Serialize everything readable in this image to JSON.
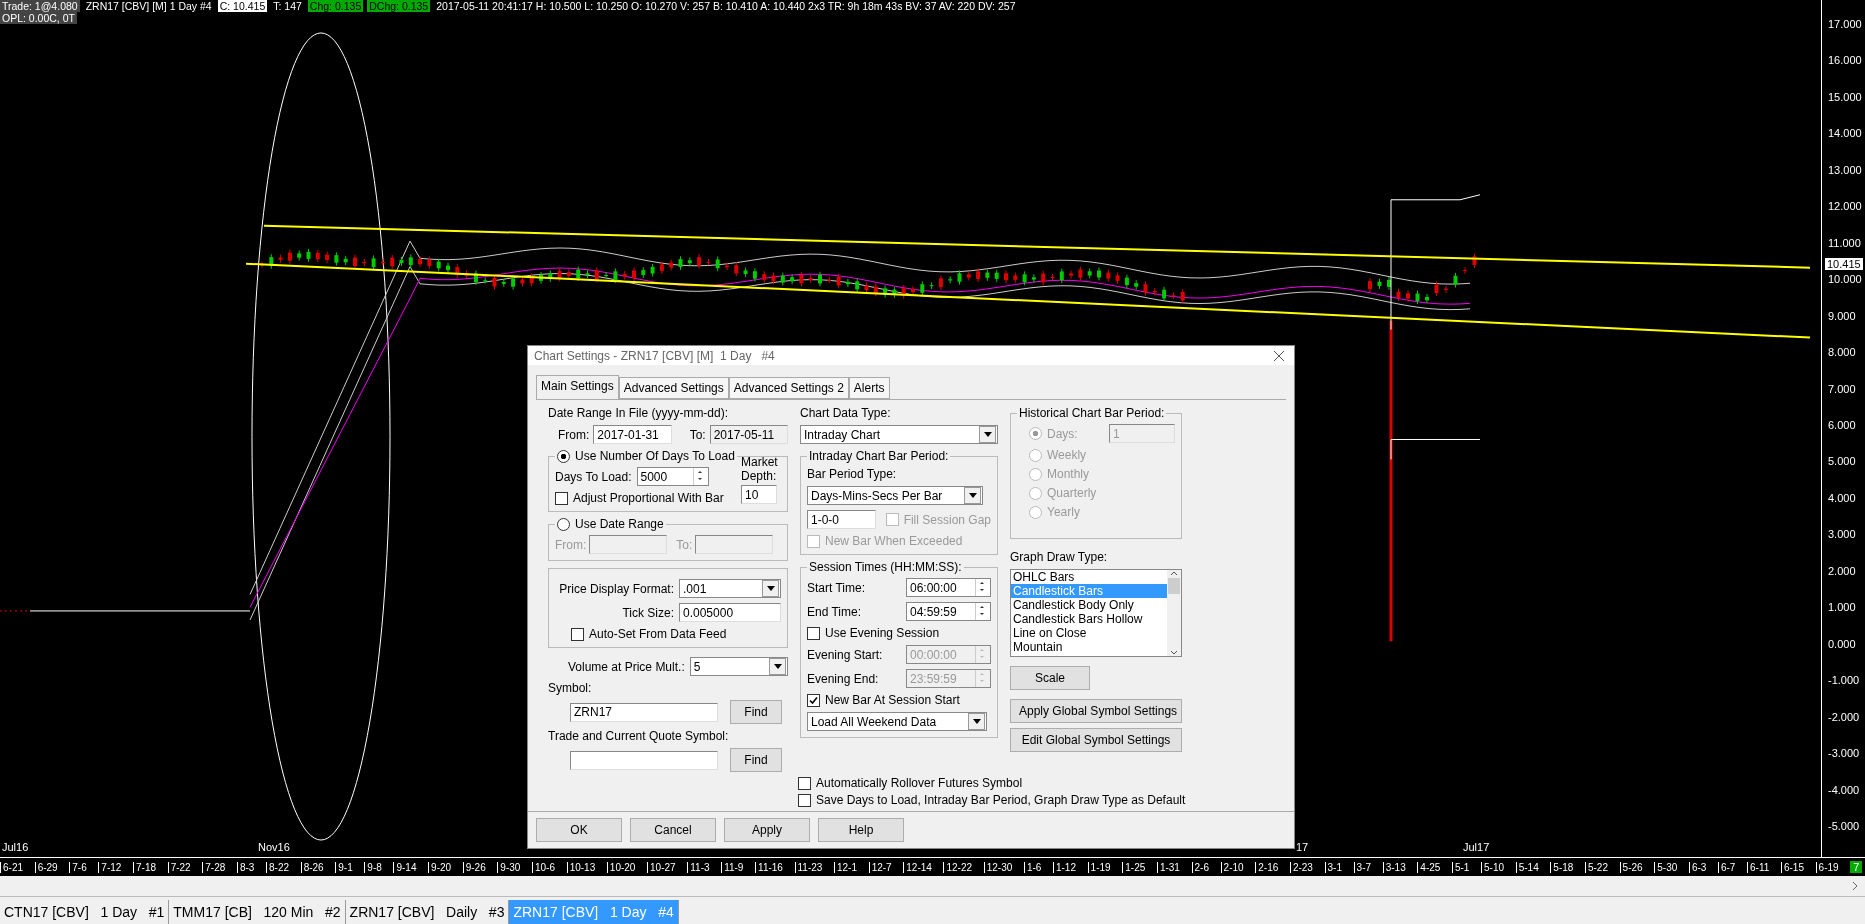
{
  "header": {
    "trade": "Trade: 1@4.080",
    "symbol": "ZRN17 [CBV] [M]  1 Day   #4",
    "close": "C: 10.415",
    "ticks": "T: 147",
    "change": "Chg: 0.135",
    "day_change": "DChg: 0.135",
    "details": "2017-05-11 20:41:17 H: 10.500 L: 10.250 O: 10.270 V: 257 B: 10.410 A: 10.440 2x3 TR: 9h 18m 43s BV: 37 AV: 220 DV: 257",
    "opl": "OPL: 0.00C, 0T"
  },
  "chart": {
    "month_labels": [
      "Jul16",
      "Nov16",
      "17",
      "Jul17"
    ],
    "price_axis": [
      "17.000",
      "16.000",
      "15.000",
      "14.000",
      "13.000",
      "12.000",
      "11.000",
      "10.000",
      "9.000",
      "8.000",
      "7.000",
      "6.000",
      "5.000",
      "4.000",
      "3.000",
      "2.000",
      "1.000",
      "0.000",
      "-1.000",
      "-2.000",
      "-3.000",
      "-4.000",
      "-5.000"
    ],
    "last_price": "10.415",
    "date_axis": [
      "6-21",
      "6-29",
      "7-6",
      "7-12",
      "7-18",
      "7-22",
      "7-28",
      "8-3",
      "8-22",
      "8-26",
      "9-1",
      "9-8",
      "9-14",
      "9-20",
      "9-26",
      "9-30",
      "10-6",
      "10-13",
      "10-20",
      "10-27",
      "11-3",
      "11-9",
      "11-16",
      "11-23",
      "12-1",
      "12-7",
      "12-14",
      "12-22",
      "12-30",
      "1-6",
      "1-12",
      "1-19",
      "1-25",
      "1-31",
      "2-6",
      "2-10",
      "2-16",
      "2-23",
      "3-1",
      "3-7",
      "3-13",
      "4-25",
      "5-1",
      "5-10",
      "5-14",
      "5-18",
      "5-22",
      "5-26",
      "5-30",
      "6-3",
      "6-7",
      "6-11",
      "6-15",
      "6-19"
    ],
    "corner_badge": "7"
  },
  "dialog": {
    "title": "Chart Settings - ZRN17 [CBV] [M]  1 Day   #4",
    "tabs": [
      {
        "label": "Main Settings",
        "selected": true
      },
      {
        "label": "Advanced Settings",
        "selected": false
      },
      {
        "label": "Advanced Settings 2",
        "selected": false
      },
      {
        "label": "Alerts",
        "selected": false
      }
    ],
    "date_range": {
      "label": "Date Range In File (yyyy-mm-dd):",
      "from_label": "From:",
      "from": "2017-01-31",
      "to_label": "To:",
      "to": "2017-05-11"
    },
    "days_group": {
      "radio": {
        "label": "Use Number Of Days To Load",
        "selected": true
      },
      "days_label": "Days To Load:",
      "days": "5000",
      "adjust": {
        "label": "Adjust Proportional With Bar",
        "checked": false
      },
      "depth_label": "Market Depth:",
      "depth": "10"
    },
    "range_group": {
      "radio": {
        "label": "Use Date Range",
        "selected": false
      },
      "from_label": "From:",
      "to_label": "To:"
    },
    "price_group": {
      "format_label": "Price Display Format:",
      "format": ".001",
      "tick_label": "Tick Size:",
      "tick": "0.005000",
      "auto_set": {
        "label": "Auto-Set From Data Feed",
        "checked": false
      }
    },
    "volume_label": "Volume at Price Mult.:",
    "volume": "5",
    "symbol_label": "Symbol:",
    "symbol": "ZRN17",
    "find": "Find",
    "quote_label": "Trade and Current Quote Symbol:",
    "quote_find": "Find",
    "data_type_label": "Chart Data Type:",
    "data_type": "Intraday Chart",
    "intraday": {
      "legend": "Intraday Chart Bar Period:",
      "type_label": "Bar Period Type:",
      "type": "Days-Mins-Secs Per Bar",
      "period": "1-0-0",
      "fill_gap": {
        "label": "Fill Session Gap",
        "checked": false,
        "disabled": true
      },
      "new_bar": {
        "label": "New Bar When Exceeded",
        "checked": false,
        "disabled": true
      }
    },
    "session": {
      "legend": "Session Times (HH:MM:SS):",
      "times": [
        {
          "label": "Start Time:",
          "value": "06:00:00"
        },
        {
          "label": "End Time:",
          "value": "04:59:59"
        }
      ],
      "evening": {
        "label": "Use Evening Session",
        "checked": false
      },
      "evening_times": [
        {
          "label": "Evening Start:",
          "value": "00:00:00",
          "disabled": true
        },
        {
          "label": "Evening End:",
          "value": "23:59:59",
          "disabled": true
        }
      ],
      "new_bar_start": {
        "label": "New Bar At Session Start",
        "checked": true
      },
      "weekend": "Load All Weekend Data"
    },
    "rollover": {
      "label": "Automatically Rollover Futures Symbol",
      "checked": false
    },
    "save_default": {
      "label": "Save Days to Load, Intraday Bar Period, Graph Draw Type as Default",
      "checked": false
    },
    "historical": {
      "legend": "Historical Chart Bar Period:",
      "days_value": "1",
      "options": [
        {
          "label": "Days:",
          "selected": true
        },
        {
          "label": "Weekly",
          "selected": false
        },
        {
          "label": "Monthly",
          "selected": false
        },
        {
          "label": "Quarterly",
          "selected": false
        },
        {
          "label": "Yearly",
          "selected": false
        }
      ]
    },
    "draw_type_label": "Graph Draw Type:",
    "draw_types": [
      {
        "label": "OHLC Bars",
        "selected": false
      },
      {
        "label": "Candlestick Bars",
        "selected": true
      },
      {
        "label": "Candlestick Body Only",
        "selected": false
      },
      {
        "label": "Candlestick Bars Hollow",
        "selected": false
      },
      {
        "label": "Line on Close",
        "selected": false
      },
      {
        "label": "Mountain",
        "selected": false
      }
    ],
    "scale": "Scale",
    "apply_global": "Apply Global Symbol Settings",
    "edit_global": "Edit Global Symbol Settings",
    "buttons": [
      "OK",
      "Cancel",
      "Apply",
      "Help"
    ]
  },
  "tabs": [
    {
      "label": "CTN17 [CBV]   1 Day   #1",
      "selected": false
    },
    {
      "label": "TMM17 [CB]   120 Min   #2",
      "selected": false
    },
    {
      "label": "ZRN17 [CBV]   Daily   #3",
      "selected": false
    },
    {
      "label": "ZRN17 [CBV]   1 Day   #4",
      "selected": true
    }
  ]
}
